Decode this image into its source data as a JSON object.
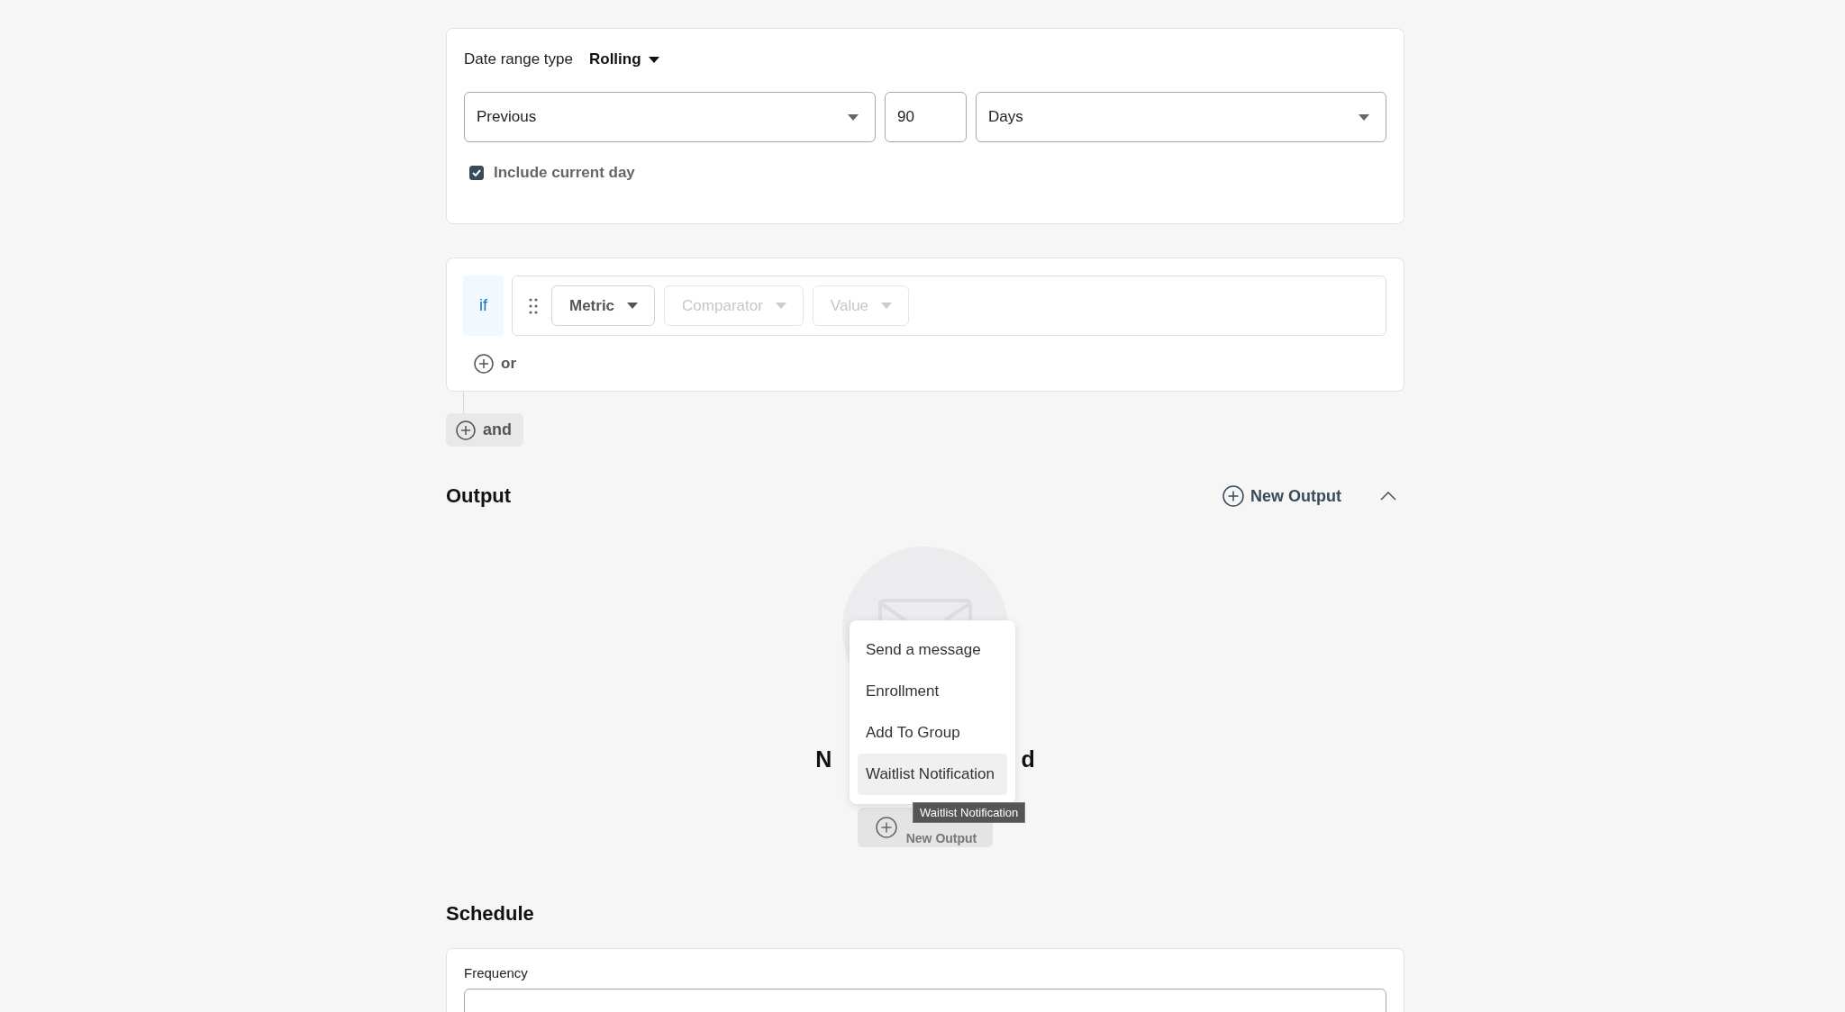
{
  "criteria": {
    "date_range_type": {
      "label": "Date range type",
      "value": "Rolling"
    },
    "direction": {
      "value": "Previous"
    },
    "amount": {
      "value": "90"
    },
    "unit": {
      "value": "Days"
    },
    "include_current_day": {
      "label": "Include current day",
      "checked": true
    }
  },
  "condition_group": {
    "keyword": "if",
    "filters": [
      {
        "label": "Metric",
        "disabled": false
      },
      {
        "label": "Comparator",
        "disabled": true
      },
      {
        "label": "Value",
        "disabled": true
      }
    ],
    "or_label": "or"
  },
  "and_button": "and",
  "output": {
    "title": "Output",
    "new_output": "New Output",
    "expanded": true,
    "empty_state": {
      "title_start": "N",
      "title_end": "d",
      "button": "New Output"
    },
    "menu": [
      {
        "label": "Send a message",
        "selected": false
      },
      {
        "label": "Enrollment",
        "selected": false
      },
      {
        "label": "Add To Group",
        "selected": false
      },
      {
        "label": "Waitlist Notification",
        "selected": true
      }
    ],
    "tooltip": "Waitlist Notification"
  },
  "schedule": {
    "title": "Schedule",
    "frequency_label": "Frequency"
  }
}
